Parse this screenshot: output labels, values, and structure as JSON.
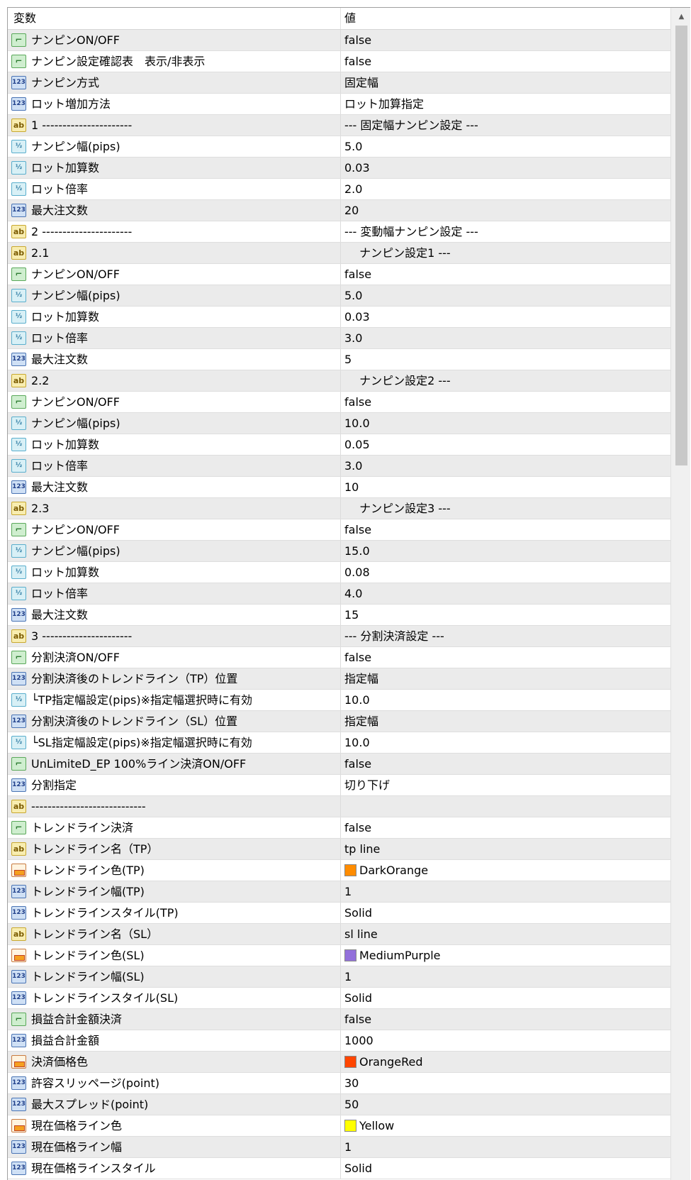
{
  "header": {
    "variable": "変数",
    "value": "値"
  },
  "rows": [
    {
      "type": "bool",
      "icon_text": "⌐",
      "name": "ナンピンON/OFF",
      "value": "false"
    },
    {
      "type": "bool",
      "icon_text": "⌐",
      "name": "ナンピン設定確認表　表示/非表示",
      "value": "false"
    },
    {
      "type": "int",
      "icon_text": "123",
      "name": "ナンピン方式",
      "value": "固定幅"
    },
    {
      "type": "int",
      "icon_text": "123",
      "name": "ロット増加方法",
      "value": "ロット加算指定"
    },
    {
      "type": "str",
      "icon_text": "ab",
      "name": "1 ----------------------",
      "value": "--- 固定幅ナンピン設定 ---"
    },
    {
      "type": "dbl",
      "icon_text": "½",
      "name": "ナンピン幅(pips)",
      "value": "5.0"
    },
    {
      "type": "dbl",
      "icon_text": "½",
      "name": "ロット加算数",
      "value": "0.03"
    },
    {
      "type": "dbl",
      "icon_text": "½",
      "name": "ロット倍率",
      "value": "2.0"
    },
    {
      "type": "int",
      "icon_text": "123",
      "name": "最大注文数",
      "value": "20"
    },
    {
      "type": "str",
      "icon_text": "ab",
      "name": "2 ----------------------",
      "value": "--- 変動幅ナンピン設定 ---"
    },
    {
      "type": "str",
      "icon_text": "ab",
      "name": "2.1",
      "value": "　 ナンピン設定1 ---"
    },
    {
      "type": "bool",
      "icon_text": "⌐",
      "name": "ナンピンON/OFF",
      "value": "false"
    },
    {
      "type": "dbl",
      "icon_text": "½",
      "name": "ナンピン幅(pips)",
      "value": "5.0"
    },
    {
      "type": "dbl",
      "icon_text": "½",
      "name": "ロット加算数",
      "value": "0.03"
    },
    {
      "type": "dbl",
      "icon_text": "½",
      "name": "ロット倍率",
      "value": "3.0"
    },
    {
      "type": "int",
      "icon_text": "123",
      "name": "最大注文数",
      "value": "5"
    },
    {
      "type": "str",
      "icon_text": "ab",
      "name": "2.2",
      "value": "　 ナンピン設定2 ---"
    },
    {
      "type": "bool",
      "icon_text": "⌐",
      "name": "ナンピンON/OFF",
      "value": "false"
    },
    {
      "type": "dbl",
      "icon_text": "½",
      "name": "ナンピン幅(pips)",
      "value": "10.0"
    },
    {
      "type": "dbl",
      "icon_text": "½",
      "name": "ロット加算数",
      "value": "0.05"
    },
    {
      "type": "dbl",
      "icon_text": "½",
      "name": "ロット倍率",
      "value": "3.0"
    },
    {
      "type": "int",
      "icon_text": "123",
      "name": "最大注文数",
      "value": "10"
    },
    {
      "type": "str",
      "icon_text": "ab",
      "name": "2.3",
      "value": "　 ナンピン設定3 ---"
    },
    {
      "type": "bool",
      "icon_text": "⌐",
      "name": "ナンピンON/OFF",
      "value": "false"
    },
    {
      "type": "dbl",
      "icon_text": "½",
      "name": "ナンピン幅(pips)",
      "value": "15.0"
    },
    {
      "type": "dbl",
      "icon_text": "½",
      "name": "ロット加算数",
      "value": "0.08"
    },
    {
      "type": "dbl",
      "icon_text": "½",
      "name": "ロット倍率",
      "value": "4.0"
    },
    {
      "type": "int",
      "icon_text": "123",
      "name": "最大注文数",
      "value": "15"
    },
    {
      "type": "str",
      "icon_text": "ab",
      "name": "3 ----------------------",
      "value": "--- 分割決済設定 ---"
    },
    {
      "type": "bool",
      "icon_text": "⌐",
      "name": "分割決済ON/OFF",
      "value": "false"
    },
    {
      "type": "int",
      "icon_text": "123",
      "name": "分割決済後のトレンドライン（TP）位置",
      "value": "指定幅"
    },
    {
      "type": "dbl",
      "icon_text": "½",
      "name": "└TP指定幅設定(pips)※指定幅選択時に有効",
      "value": "10.0"
    },
    {
      "type": "int",
      "icon_text": "123",
      "name": "分割決済後のトレンドライン（SL）位置",
      "value": "指定幅"
    },
    {
      "type": "dbl",
      "icon_text": "½",
      "name": "└SL指定幅設定(pips)※指定幅選択時に有効",
      "value": "10.0"
    },
    {
      "type": "bool",
      "icon_text": "⌐",
      "name": "UnLimiteD_EP 100%ライン決済ON/OFF",
      "value": "false"
    },
    {
      "type": "int",
      "icon_text": "123",
      "name": "分割指定",
      "value": "切り下げ"
    },
    {
      "type": "str",
      "icon_text": "ab",
      "name": "----------------------------",
      "value": ""
    },
    {
      "type": "bool",
      "icon_text": "⌐",
      "name": "トレンドライン決済",
      "value": "false"
    },
    {
      "type": "str",
      "icon_text": "ab",
      "name": "トレンドライン名（TP）",
      "value": "tp line"
    },
    {
      "type": "clr",
      "icon_text": "",
      "name": "トレンドライン色(TP)",
      "value": "DarkOrange",
      "swatch": "#ff8c00"
    },
    {
      "type": "int",
      "icon_text": "123",
      "name": "トレンドライン幅(TP)",
      "value": "1"
    },
    {
      "type": "int",
      "icon_text": "123",
      "name": "トレンドラインスタイル(TP)",
      "value": "Solid"
    },
    {
      "type": "str",
      "icon_text": "ab",
      "name": "トレンドライン名（SL）",
      "value": "sl line"
    },
    {
      "type": "clr",
      "icon_text": "",
      "name": "トレンドライン色(SL)",
      "value": "MediumPurple",
      "swatch": "#9370db"
    },
    {
      "type": "int",
      "icon_text": "123",
      "name": "トレンドライン幅(SL)",
      "value": "1"
    },
    {
      "type": "int",
      "icon_text": "123",
      "name": "トレンドラインスタイル(SL)",
      "value": "Solid"
    },
    {
      "type": "bool",
      "icon_text": "⌐",
      "name": "損益合計金額決済",
      "value": "false"
    },
    {
      "type": "int",
      "icon_text": "123",
      "name": "損益合計金額",
      "value": "1000"
    },
    {
      "type": "clr",
      "icon_text": "",
      "name": "決済価格色",
      "value": "OrangeRed",
      "swatch": "#ff4500"
    },
    {
      "type": "int",
      "icon_text": "123",
      "name": "許容スリッページ(point)",
      "value": "30"
    },
    {
      "type": "int",
      "icon_text": "123",
      "name": "最大スプレッド(point)",
      "value": "50"
    },
    {
      "type": "clr",
      "icon_text": "",
      "name": "現在価格ライン色",
      "value": "Yellow",
      "swatch": "#ffff00"
    },
    {
      "type": "int",
      "icon_text": "123",
      "name": "現在価格ライン幅",
      "value": "1"
    },
    {
      "type": "int",
      "icon_text": "123",
      "name": "現在価格ラインスタイル",
      "value": "Solid"
    }
  ],
  "scrollbar": {
    "up_arrow_icon": "chevron-up-icon"
  }
}
